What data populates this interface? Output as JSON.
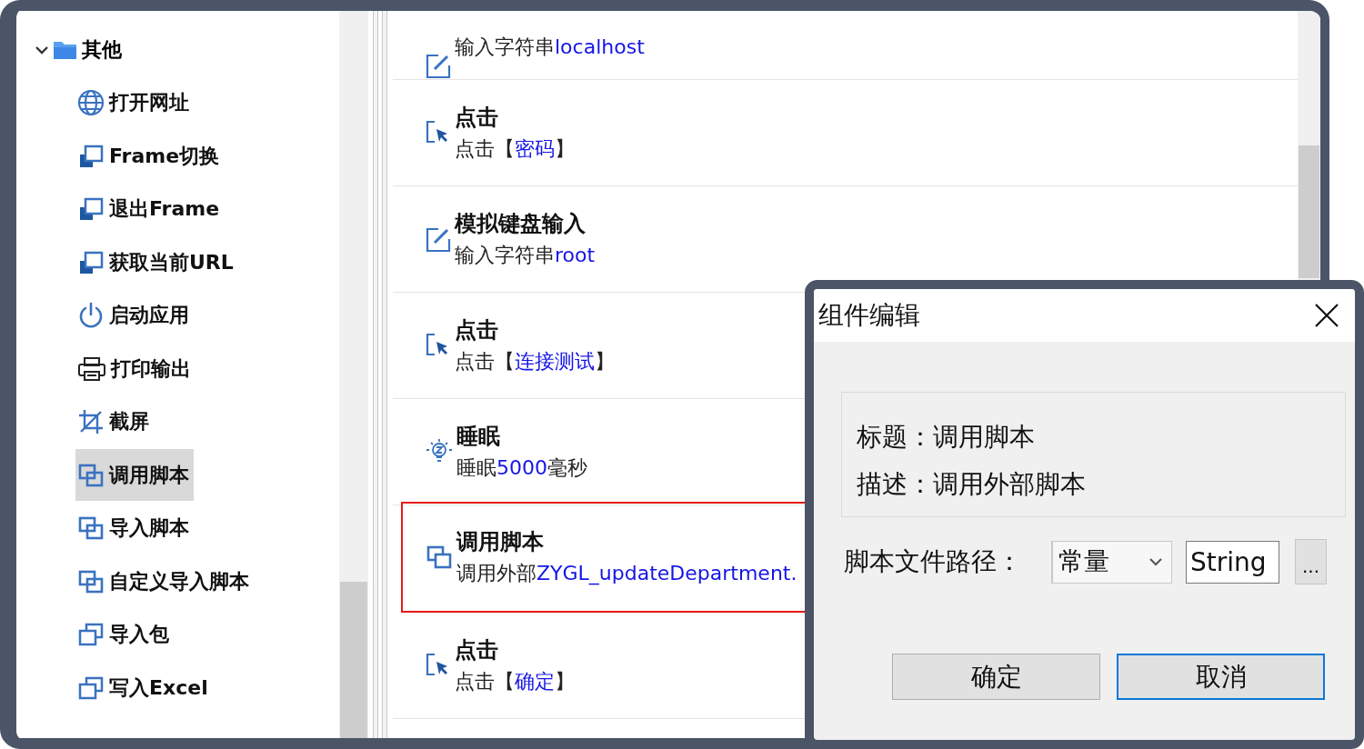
{
  "tree": {
    "label": "其他",
    "expanded": true,
    "children": [
      {
        "label": "打开网址",
        "kind": "navigate",
        "selected": false
      },
      {
        "label": "Frame切换",
        "kind": "frame",
        "selected": false
      },
      {
        "label": "退出Frame",
        "kind": "frame",
        "selected": false
      },
      {
        "label": "获取当前URL",
        "kind": "frame",
        "selected": false
      },
      {
        "label": "启动应用",
        "kind": "app",
        "selected": false
      },
      {
        "label": "打印输出",
        "kind": "print",
        "selected": false
      },
      {
        "label": "截屏",
        "kind": "screenshot",
        "selected": false
      },
      {
        "label": "调用脚本",
        "kind": "script",
        "selected": true
      },
      {
        "label": "导入脚本",
        "kind": "script",
        "selected": false
      },
      {
        "label": "自定义导入脚本",
        "kind": "script",
        "selected": false
      },
      {
        "label": "导入包",
        "kind": "package",
        "selected": false
      },
      {
        "label": "写入Excel",
        "kind": "package",
        "selected": false
      }
    ]
  },
  "steps": [
    {
      "kind": "input",
      "prefix": "输入字符串",
      "value": "localhost",
      "selected": false
    },
    {
      "kind": "click",
      "title": "点击",
      "prefix": "点击【",
      "value": "密码",
      "suffix": "】",
      "selected": false
    },
    {
      "kind": "input",
      "title": "模拟键盘输入",
      "prefix": "输入字符串",
      "value": "root",
      "selected": false
    },
    {
      "kind": "click",
      "title": "点击",
      "prefix": "点击【",
      "value": "连接测试",
      "suffix": "】",
      "selected": false
    },
    {
      "kind": "sleep",
      "title": "睡眠",
      "prefix": "睡眠",
      "value": "5000",
      "suffix": "毫秒",
      "selected": false
    },
    {
      "kind": "script",
      "title": "调用脚本",
      "prefix": "调用外部",
      "value": "ZYGL_updateDepartment.",
      "selected": true
    },
    {
      "kind": "click",
      "title": "点击",
      "prefix": "点击【",
      "value": "确定",
      "suffix": "】",
      "selected": false
    }
  ],
  "dialog": {
    "title": "组件编辑",
    "info": [
      {
        "label": "标题：",
        "value": "调用脚本"
      },
      {
        "label": "描述：",
        "value": "调用外部脚本"
      }
    ],
    "path": {
      "label": "脚本文件路径：",
      "mode": "常量",
      "type": "String",
      "browse": "..."
    },
    "buttons": [
      {
        "label": "确定",
        "default": false
      },
      {
        "label": "取消",
        "default": true
      }
    ]
  }
}
